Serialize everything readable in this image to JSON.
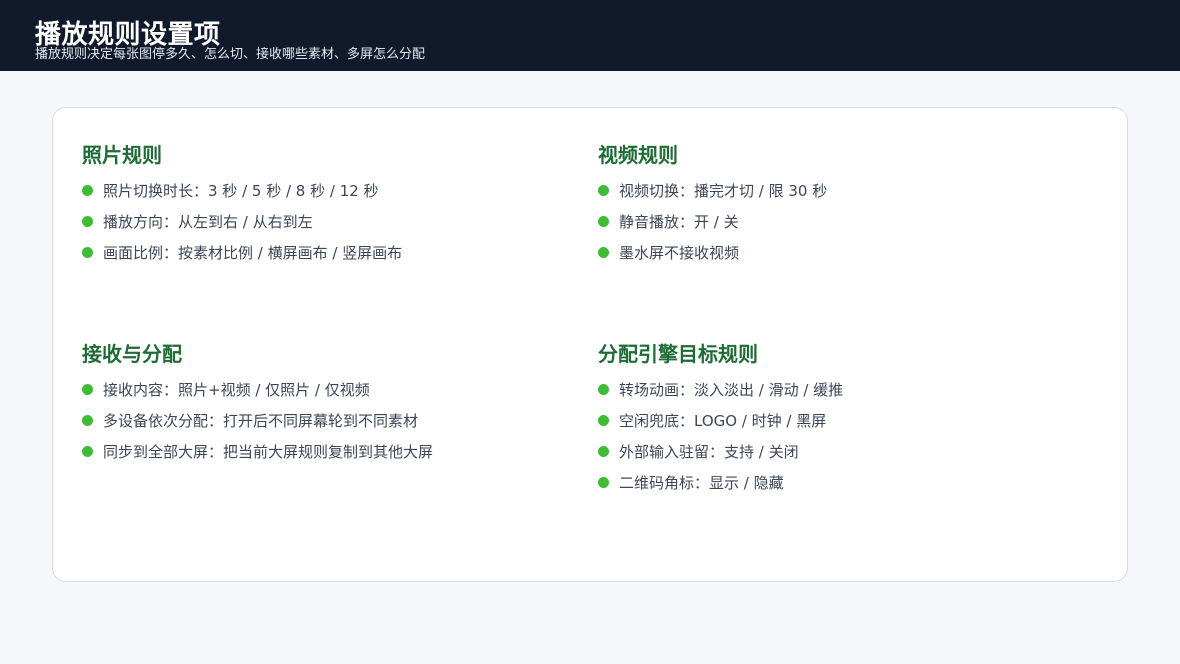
{
  "header": {
    "title": "播放规则设置项",
    "subtitle": "播放规则决定每张图停多久、怎么切、接收哪些素材、多屏怎么分配"
  },
  "colors": {
    "header_bg": "#111a2b",
    "section_title": "#1f6b35",
    "bullet": "#3fbb36",
    "body_text": "#3b4657"
  },
  "sections": [
    {
      "title": "照片规则",
      "items": [
        "照片切换时长：3 秒 / 5 秒 / 8 秒 / 12 秒",
        "播放方向：从左到右 / 从右到左",
        "画面比例：按素材比例 / 横屏画布 / 竖屏画布"
      ]
    },
    {
      "title": "视频规则",
      "items": [
        "视频切换：播完才切 / 限 30 秒",
        "静音播放：开 / 关",
        "墨水屏不接收视频"
      ]
    },
    {
      "title": "接收与分配",
      "items": [
        "接收内容：照片+视频 / 仅照片 / 仅视频",
        "多设备依次分配：打开后不同屏幕轮到不同素材",
        "同步到全部大屏：把当前大屏规则复制到其他大屏"
      ]
    },
    {
      "title": "分配引擎目标规则",
      "items": [
        "转场动画：淡入淡出 / 滑动 / 缓推",
        "空闲兜底：LOGO / 时钟 / 黑屏",
        "外部输入驻留：支持 / 关闭",
        "二维码角标：显示 / 隐藏"
      ]
    }
  ]
}
